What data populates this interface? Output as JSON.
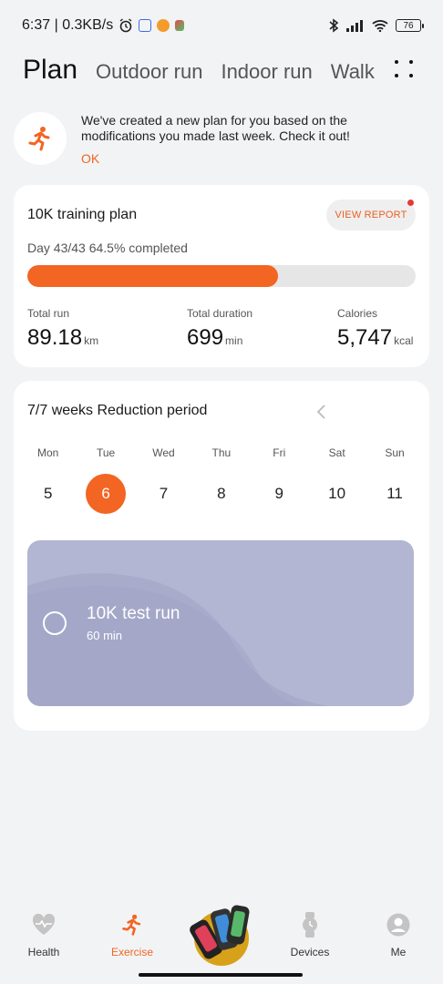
{
  "status": {
    "time_speed": "6:37 | 0.3KB/s",
    "battery": "76"
  },
  "tabs": [
    {
      "label": "Plan"
    },
    {
      "label": "Outdoor run"
    },
    {
      "label": "Indoor run"
    },
    {
      "label": "Walk"
    }
  ],
  "notice": {
    "message": "We've created a new plan for you based on the modifications you made last week. Check it out!",
    "ok_label": "OK"
  },
  "plan": {
    "title": "10K training plan",
    "report_label": "VIEW REPORT",
    "progress_text": "Day 43/43 64.5% completed",
    "progress_percent": 64.5,
    "stats": [
      {
        "label": "Total run",
        "value": "89.18",
        "unit": "km"
      },
      {
        "label": "Total duration",
        "value": "699",
        "unit": "min"
      },
      {
        "label": "Calories",
        "value": "5,747",
        "unit": "kcal"
      }
    ]
  },
  "week": {
    "title": "7/7 weeks Reduction period",
    "days": [
      {
        "name": "Mon",
        "date": "5"
      },
      {
        "name": "Tue",
        "date": "6",
        "selected": true
      },
      {
        "name": "Wed",
        "date": "7"
      },
      {
        "name": "Thu",
        "date": "8"
      },
      {
        "name": "Fri",
        "date": "9"
      },
      {
        "name": "Sat",
        "date": "10"
      },
      {
        "name": "Sun",
        "date": "11"
      }
    ],
    "task": {
      "name": "10K test run",
      "duration": "60 min"
    }
  },
  "nav": [
    {
      "label": "Health",
      "icon": "heart-pulse-icon"
    },
    {
      "label": "Exercise",
      "icon": "runner-icon",
      "active": true
    },
    {
      "label": "",
      "icon": "device-image"
    },
    {
      "label": "Devices",
      "icon": "watch-icon"
    },
    {
      "label": "Me",
      "icon": "person-icon"
    }
  ],
  "colors": {
    "accent": "#f26522",
    "background": "#f2f3f5",
    "task_card": "#b3b6d2",
    "notification_dot": "#e53935"
  }
}
